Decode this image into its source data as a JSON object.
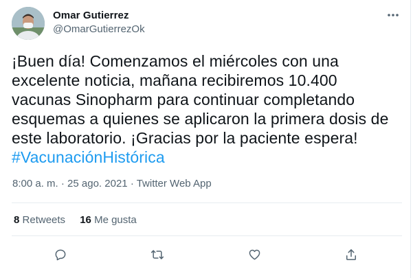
{
  "author": {
    "name": "Omar Gutierrez",
    "handle": "@OmarGutierrezOk"
  },
  "tweet": {
    "lines": [
      "¡Buen día! Comenzamos el miércoles con una",
      "excelente noticia, mañana recibiremos 10.400",
      "vacunas Sinopharm para continuar completando",
      "esquemas a quienes se aplicaron la primera dosis de",
      "este laboratorio. ¡Gracias por la paciente espera!"
    ],
    "hashtag": "#VacunaciónHistórica"
  },
  "meta": {
    "time": "8:00 a. m.",
    "separator": "·",
    "date": "25 ago. 2021",
    "source": "Twitter Web App"
  },
  "stats": {
    "retweets_count": "8",
    "retweets_label": "Retweets",
    "likes_count": "16",
    "likes_label": "Me gusta"
  },
  "icons": {
    "more": "more-dots-icon",
    "reply": "reply-icon",
    "retweet": "retweet-icon",
    "like": "heart-icon",
    "share": "share-icon"
  },
  "colors": {
    "text": "#0f1419",
    "secondary": "#536471",
    "link": "#1d9bf0",
    "border": "#e6ecf0"
  }
}
